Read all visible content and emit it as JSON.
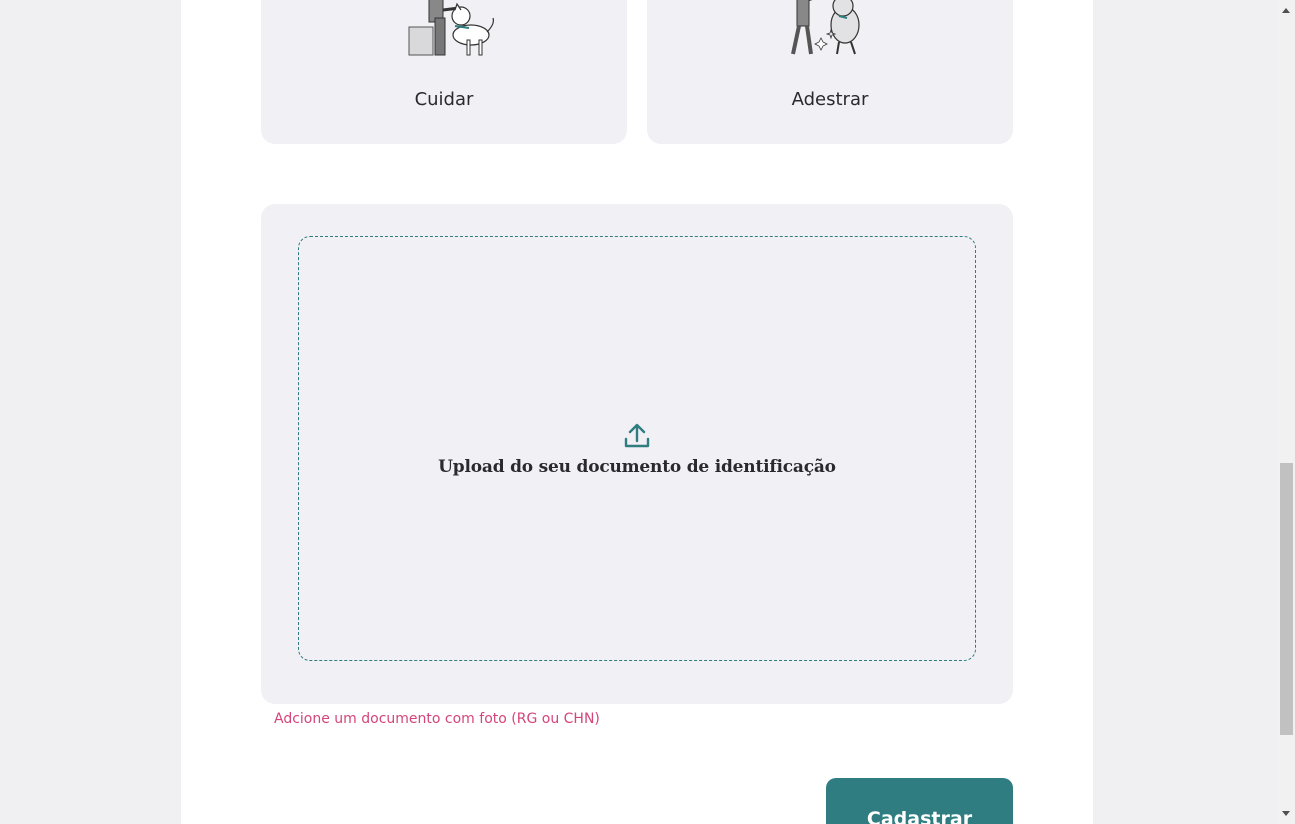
{
  "services": [
    {
      "label": "Cuidar",
      "icon": "person-petting-dog-illustration"
    },
    {
      "label": "Adestrar",
      "icon": "person-training-dog-illustration"
    }
  ],
  "upload": {
    "icon": "upload-icon",
    "text": "Upload do seu documento de identificação",
    "hint": "Adcione um documento com foto (RG ou CHN)"
  },
  "submit": {
    "label": "Cadastrar"
  },
  "colors": {
    "accent": "#2f7d80",
    "hint": "#d4457a",
    "card_bg": "#f0f0f5",
    "page_bg": "#ffffff",
    "outer_bg": "#f0f0f2"
  }
}
